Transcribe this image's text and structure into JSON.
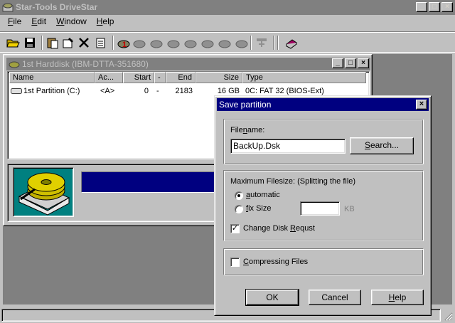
{
  "app": {
    "title": "Star-Tools DriveStar",
    "minimize": "_",
    "maximize": "□",
    "close": "×"
  },
  "menu": [
    {
      "pre": "",
      "key": "F",
      "post": "ile"
    },
    {
      "pre": "",
      "key": "E",
      "post": "dit"
    },
    {
      "pre": "",
      "key": "W",
      "post": "indow"
    },
    {
      "pre": "",
      "key": "H",
      "post": "elp"
    }
  ],
  "toolbar_icons": [
    "open-folder-icon",
    "save-icon",
    "paste-icon",
    "properties-icon",
    "delete-icon",
    "new-document-icon",
    "disk-1-icon",
    "disk-2-icon",
    "disk-3-icon",
    "disk-4-icon",
    "disk-5-icon",
    "disk-6-icon",
    "disk-7-icon",
    "disk-8-icon",
    "network-icon",
    "book-icon"
  ],
  "child": {
    "title": "1st Harddisk (IBM-DTTA-351680)",
    "columns": [
      "Name",
      "Ac...",
      "Start",
      "-",
      "End",
      "Size",
      "Type"
    ],
    "rows": [
      {
        "name": "1st Partition (C:)",
        "active": "<A>",
        "start": "0",
        "dash": "-",
        "end": "2183",
        "size": "16 GB",
        "type": "0C: FAT 32 (BIOS-Ext)"
      }
    ]
  },
  "dialog": {
    "title": "Save partition",
    "filename_label_pre": "File",
    "filename_label_key": "n",
    "filename_label_post": "ame:",
    "filename_value": "BackUp.Dsk",
    "search_pre": "",
    "search_key": "S",
    "search_post": "earch...",
    "max_label": "Maximum Filesize: (Splitting the file)",
    "auto_pre": "",
    "auto_key": "a",
    "auto_post": "utomatic",
    "fix_pre": "",
    "fix_key": "f",
    "fix_post": "ix Size",
    "fix_value": "",
    "kb_label": "KB",
    "change_pre": "Change Disk ",
    "change_key": "R",
    "change_post": "equst",
    "compress_pre": "",
    "compress_key": "C",
    "compress_post": "ompressing Files",
    "ok": "OK",
    "cancel": "Cancel",
    "help_pre": "",
    "help_key": "H",
    "help_post": "elp",
    "automatic_selected": true,
    "change_checked": true,
    "compress_checked": false
  },
  "colors": {
    "accent": "#000080",
    "disk_bg": "#008080"
  }
}
